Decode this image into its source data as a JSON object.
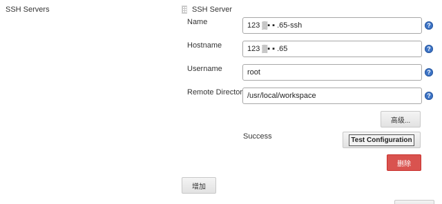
{
  "section": {
    "label": "SSH Servers"
  },
  "server": {
    "title": "SSH Server"
  },
  "fields": [
    {
      "label": "Name",
      "value": "123 ▒▪ ▪ .65-ssh"
    },
    {
      "label": "Hostname",
      "value": "123 ▒▪ ▪ .65"
    },
    {
      "label": "Username",
      "value": "root"
    },
    {
      "label": "Remote Directory",
      "value": "/usr/local/workspace"
    }
  ],
  "help": {
    "glyph": "?"
  },
  "buttons": {
    "advanced": "高级...",
    "test": "Test Configuration",
    "delete": "删除",
    "add": "增加",
    "bottom": ""
  },
  "status": {
    "text": "Success"
  },
  "colors": {
    "help": "#3d74c6",
    "delete": "#d9534f"
  },
  "icons": {
    "drag": "grip-icon",
    "help": "help-icon"
  }
}
